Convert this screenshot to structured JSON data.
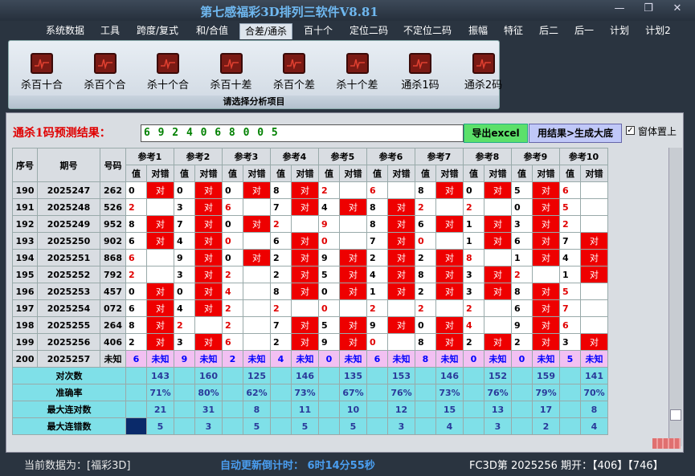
{
  "title": "第七感福彩3D排列三软件V8.81",
  "menu": [
    "系统数据",
    "工具",
    "跨度/复式",
    "和/合值",
    "合差/通杀",
    "百十个",
    "定位二码",
    "不定位二码",
    "振幅",
    "特征",
    "后二",
    "后一",
    "计划",
    "计划2"
  ],
  "ribbon": {
    "buttons": [
      "杀百十合",
      "杀百个合",
      "杀十个合",
      "杀百十差",
      "杀百个差",
      "杀十个差",
      "通杀1码",
      "通杀2码"
    ],
    "caption": "请选择分析项目"
  },
  "prediction": {
    "label": "通杀1码预测结果：",
    "value": "6 9 2 4 0 6 8 0 0 5",
    "export": "导出excel",
    "generate": "用结果>生成大底",
    "pin_label": "窗体置上",
    "pin_check": "✓"
  },
  "table": {
    "headers": [
      "序号",
      "期号",
      "号码"
    ],
    "refs": [
      "参考1",
      "参考2",
      "参考3",
      "参考4",
      "参考5",
      "参考6",
      "参考7",
      "参考8",
      "参考9",
      "参考10"
    ],
    "sub": [
      "值",
      "对错"
    ],
    "rows": [
      {
        "seq": "190",
        "period": "2025247",
        "num": "262",
        "v": [
          "0",
          "0",
          "0",
          "8",
          "2",
          "6",
          "8",
          "0",
          "5",
          "6"
        ],
        "h": [
          1,
          1,
          1,
          1,
          0,
          0,
          1,
          1,
          1,
          0
        ]
      },
      {
        "seq": "191",
        "period": "2025248",
        "num": "526",
        "v": [
          "2",
          "3",
          "6",
          "7",
          "4",
          "8",
          "2",
          "2",
          "0",
          "5"
        ],
        "h": [
          0,
          1,
          0,
          1,
          1,
          1,
          0,
          0,
          1,
          0
        ]
      },
      {
        "seq": "192",
        "period": "2025249",
        "num": "952",
        "v": [
          "8",
          "7",
          "0",
          "2",
          "9",
          "8",
          "6",
          "1",
          "3",
          "2"
        ],
        "h": [
          1,
          1,
          1,
          0,
          0,
          1,
          1,
          1,
          1,
          0
        ]
      },
      {
        "seq": "193",
        "period": "2025250",
        "num": "902",
        "v": [
          "6",
          "4",
          "0",
          "6",
          "0",
          "7",
          "0",
          "1",
          "6",
          "7"
        ],
        "h": [
          1,
          1,
          0,
          1,
          0,
          1,
          0,
          1,
          1,
          1
        ]
      },
      {
        "seq": "194",
        "period": "2025251",
        "num": "868",
        "v": [
          "6",
          "9",
          "0",
          "2",
          "9",
          "2",
          "2",
          "8",
          "1",
          "4"
        ],
        "h": [
          0,
          1,
          1,
          1,
          1,
          1,
          1,
          0,
          1,
          1
        ]
      },
      {
        "seq": "195",
        "period": "2025252",
        "num": "792",
        "v": [
          "2",
          "3",
          "2",
          "2",
          "5",
          "4",
          "8",
          "3",
          "2",
          "1"
        ],
        "h": [
          0,
          1,
          0,
          1,
          1,
          1,
          1,
          1,
          0,
          1
        ]
      },
      {
        "seq": "196",
        "period": "2025253",
        "num": "457",
        "v": [
          "0",
          "0",
          "4",
          "8",
          "0",
          "1",
          "2",
          "3",
          "8",
          "5"
        ],
        "h": [
          1,
          1,
          0,
          1,
          1,
          1,
          1,
          1,
          1,
          0
        ]
      },
      {
        "seq": "197",
        "period": "2025254",
        "num": "072",
        "v": [
          "6",
          "4",
          "2",
          "2",
          "0",
          "2",
          "2",
          "2",
          "6",
          "7"
        ],
        "h": [
          1,
          1,
          0,
          0,
          0,
          0,
          0,
          0,
          1,
          0
        ]
      },
      {
        "seq": "198",
        "period": "2025255",
        "num": "264",
        "v": [
          "8",
          "2",
          "2",
          "7",
          "5",
          "9",
          "0",
          "4",
          "9",
          "6"
        ],
        "h": [
          1,
          0,
          0,
          1,
          1,
          1,
          1,
          0,
          1,
          0
        ]
      },
      {
        "seq": "199",
        "period": "2025256",
        "num": "406",
        "v": [
          "2",
          "3",
          "6",
          "2",
          "9",
          "0",
          "8",
          "2",
          "2",
          "3"
        ],
        "h": [
          1,
          1,
          0,
          1,
          1,
          0,
          1,
          1,
          1,
          1
        ]
      }
    ],
    "predict_row": {
      "seq": "200",
      "period": "2025257",
      "num": "未知",
      "v": [
        "6",
        "9",
        "2",
        "4",
        "0",
        "6",
        "8",
        "0",
        "0",
        "5"
      ],
      "unk": "未知"
    },
    "summary": [
      {
        "label": "对次数",
        "vals": [
          "143",
          "160",
          "125",
          "146",
          "135",
          "153",
          "146",
          "152",
          "159",
          "141"
        ]
      },
      {
        "label": "准确率",
        "vals": [
          "71%",
          "80%",
          "62%",
          "73%",
          "67%",
          "76%",
          "73%",
          "76%",
          "79%",
          "70%"
        ]
      },
      {
        "label": "最大连对数",
        "vals": [
          "21",
          "31",
          "8",
          "11",
          "10",
          "12",
          "15",
          "13",
          "17",
          "8"
        ]
      },
      {
        "label": "最大连错数",
        "vals": [
          "5",
          "3",
          "5",
          "5",
          "5",
          "3",
          "4",
          "3",
          "2",
          "4"
        ]
      }
    ],
    "hit_mark": "对"
  },
  "status": {
    "data_label": "当前数据为：[福彩3D]",
    "countdown": "自动更新倒计时： 6时14分55秒",
    "issue": "FC3D第 2025256 期开：【406】【746】"
  },
  "colors": {
    "hit": "#ee0000",
    "unknown_bg": "#f2c0f2",
    "summary_bg": "#7fe0e8",
    "title": "#6fb8f0"
  }
}
